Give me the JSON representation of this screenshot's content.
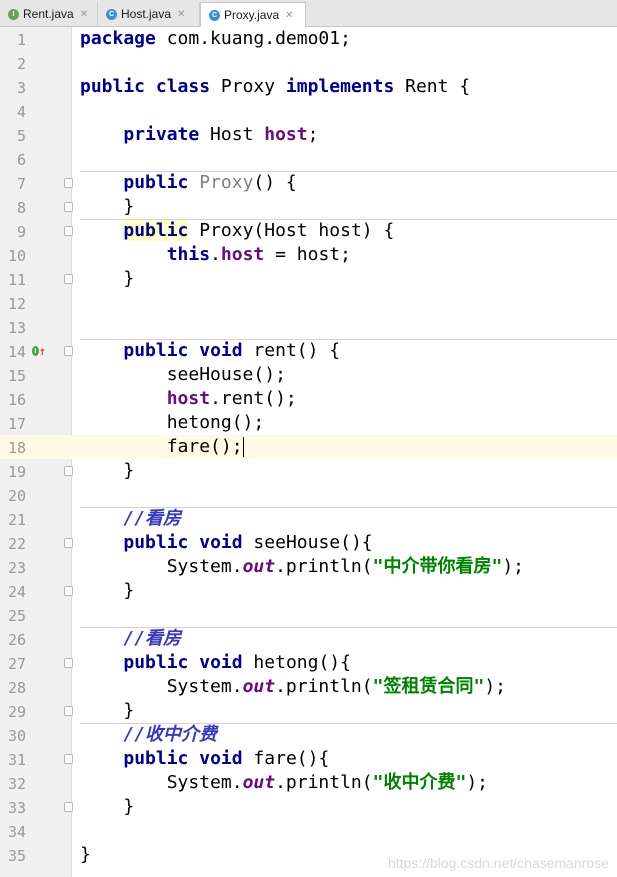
{
  "tabs": [
    {
      "name": "Rent.java",
      "icon": "I",
      "icon_color": "#6aa25a",
      "active": false
    },
    {
      "name": "Host.java",
      "icon": "C",
      "icon_color": "#3b8fd1",
      "active": false
    },
    {
      "name": "Proxy.java",
      "icon": "C",
      "icon_color": "#3b8fd1",
      "active": true
    }
  ],
  "line_numbers": [
    "1",
    "2",
    "3",
    "4",
    "5",
    "6",
    "7",
    "8",
    "9",
    "10",
    "11",
    "12",
    "13",
    "14",
    "15",
    "16",
    "17",
    "18",
    "19",
    "20",
    "21",
    "22",
    "23",
    "24",
    "25",
    "26",
    "27",
    "28",
    "29",
    "30",
    "31",
    "32",
    "33",
    "34",
    "35"
  ],
  "code": {
    "l1_kw": "package",
    "l1_rest": " com.kuang.demo01;",
    "l3_kw1": "public",
    "l3_kw2": "class",
    "l3_name": " Proxy ",
    "l3_kw3": "implements",
    "l3_rest": " Rent {",
    "l5_kw": "private",
    "l5_type": " Host ",
    "l5_field": "host",
    "l5_end": ";",
    "l7_kw": "public",
    "l7_name": "Proxy",
    "l7_end": "() {",
    "l8": "}",
    "l9_kw": "public",
    "l9_rest": " Proxy(Host host) {",
    "l10_kw": "this",
    "l10_dot": ".",
    "l10_field": "host",
    "l10_rest": " = host;",
    "l11": "}",
    "l14_kw1": "public",
    "l14_kw2": "void",
    "l14_rest": " rent() {",
    "l15": "seeHouse();",
    "l16_field": "host",
    "l16_rest": ".rent();",
    "l17": "hetong();",
    "l18": "fare();",
    "l19": "}",
    "l21_comment": "//看房",
    "l22_kw1": "public",
    "l22_kw2": "void",
    "l22_rest": " seeHouse(){",
    "l23_pre": "System.",
    "l23_static": "out",
    "l23_mid": ".println(",
    "l23_str": "\"中介带你看房\"",
    "l23_end": ");",
    "l24": "}",
    "l26_comment": "//看房",
    "l27_kw1": "public",
    "l27_kw2": "void",
    "l27_rest": " hetong(){",
    "l28_pre": "System.",
    "l28_static": "out",
    "l28_mid": ".println(",
    "l28_str": "\"签租赁合同\"",
    "l28_end": ");",
    "l29": "}",
    "l30_comment": "//收中介费",
    "l31_kw1": "public",
    "l31_kw2": "void",
    "l31_rest": " fare(){",
    "l32_pre": "System.",
    "l32_static": "out",
    "l32_mid": ".println(",
    "l32_str": "\"收中介费\"",
    "l32_end": ");",
    "l33": "}",
    "l35": "}"
  },
  "watermark": "https://blog.csdn.net/chasemanrose",
  "colors": {
    "keyword": "#000080",
    "field": "#660e7a",
    "string": "#008000",
    "comment": "#3a3ab8",
    "current_line": "#fffae3"
  }
}
